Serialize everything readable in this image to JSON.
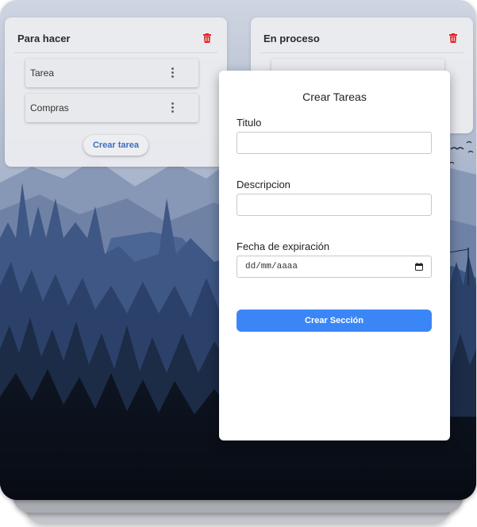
{
  "board": {
    "columns": [
      {
        "title": "Para hacer",
        "tasks": [
          "Tarea",
          "Compras"
        ],
        "create_label": "Crear tarea"
      },
      {
        "title": "En proceso"
      }
    ]
  },
  "modal": {
    "title": "Crear Tareas",
    "fields": {
      "titulo_label": "Titulo",
      "titulo_value": "",
      "descripcion_label": "Descripcion",
      "descripcion_value": "",
      "fecha_label": "Fecha de expiración",
      "fecha_placeholder": "dd/mm/aaaa"
    },
    "submit_label": "Crear Sección"
  },
  "colors": {
    "accent": "#3b86f6",
    "danger": "#e02424",
    "link": "#3b6dbf"
  },
  "icons": [
    "trash-icon",
    "kebab-menu-icon",
    "calendar-icon"
  ]
}
